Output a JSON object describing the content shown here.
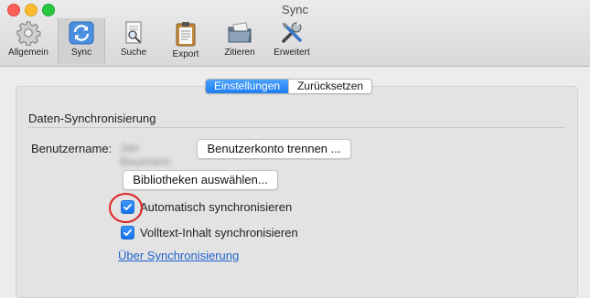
{
  "window": {
    "title": "Sync"
  },
  "toolbar": {
    "items": [
      {
        "label": "Allgemein",
        "icon": "gear-icon"
      },
      {
        "label": "Sync",
        "icon": "sync-icon",
        "selected": true
      },
      {
        "label": "Suche",
        "icon": "search-icon"
      },
      {
        "label": "Export",
        "icon": "clipboard-icon"
      },
      {
        "label": "Zitieren",
        "icon": "folder-icon"
      },
      {
        "label": "Erweitert",
        "icon": "tools-icon"
      }
    ]
  },
  "tabs": {
    "items": [
      {
        "label": "Einstellungen",
        "active": true
      },
      {
        "label": "Zurücksetzen",
        "active": false
      }
    ]
  },
  "section": {
    "title": "Daten-Synchronisierung"
  },
  "account": {
    "label": "Benutzername:",
    "username": "Jan Baumann",
    "unlink_button": "Benutzerkonto trennen ...",
    "libraries_button": "Bibliotheken auswählen..."
  },
  "options": {
    "auto_sync": {
      "label": "Automatisch synchronisieren",
      "checked": true
    },
    "fulltext_sync": {
      "label": "Volltext-Inhalt synchronisieren",
      "checked": true
    }
  },
  "about_link": "Über Synchronisierung",
  "colors": {
    "accent": "#1c7cf3",
    "link": "#2063d0",
    "highlight_circle": "#df2020"
  }
}
